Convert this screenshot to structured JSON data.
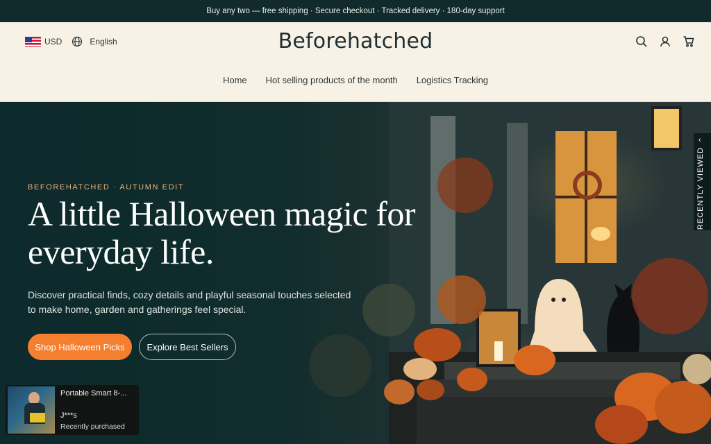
{
  "announcement": {
    "icon": "gift-icon",
    "text": " Buy any two — free shipping · Secure checkout · Tracked delivery · 180-day support"
  },
  "header": {
    "currency": "USD",
    "currency_flag": "us-flag-icon",
    "language": "English",
    "brand": "Beforehatched",
    "icons": [
      "search-icon",
      "user-icon",
      "cart-icon"
    ],
    "nav": [
      "Home",
      "Hot selling products of the month",
      "Logistics Tracking"
    ]
  },
  "hero": {
    "eyebrow": "BEFOREHATCHED · AUTUMN EDIT",
    "title": "A little Halloween magic for everyday life.",
    "description": "Discover practical finds, cozy details and playful seasonal touches selected to make home, garden and gatherings feel special.",
    "primary_button": "Shop Halloween Picks",
    "secondary_button": "Explore Best Sellers"
  },
  "recently_viewed": {
    "label": "RECENTLY VIEWED",
    "icon": "chevron-left-icon"
  },
  "purchase_toast": {
    "product": " Portable Smart 8-...",
    "buyer": "J***s",
    "status": "Recently purchased"
  },
  "colors": {
    "announcement_bg": "#112a2c",
    "header_bg": "#f8f1e6",
    "accent": "#f37f2f",
    "eyebrow": "#e8b27a",
    "hero_bg": "#0d2a2c"
  }
}
